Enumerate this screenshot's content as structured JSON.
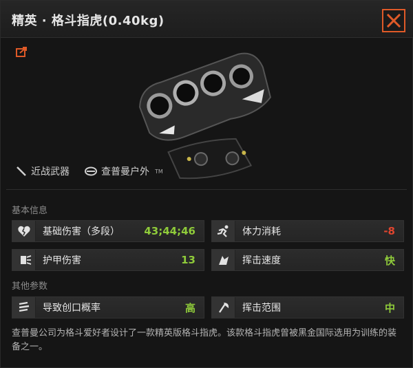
{
  "title": "精英 · 格斗指虎(0.40kg)",
  "tags": {
    "weapon_type": "近战武器",
    "brand": "查普曼户外",
    "brand_mark": "TM"
  },
  "sections": {
    "basic": "基本信息",
    "other": "其他参数"
  },
  "stats": {
    "base_damage": {
      "label": "基础伤害（多段）",
      "value": "43;44;46"
    },
    "stamina_cost": {
      "label": "体力消耗",
      "value": "-8"
    },
    "armor_damage": {
      "label": "护甲伤害",
      "value": "13"
    },
    "swing_speed": {
      "label": "挥击速度",
      "value": "快"
    },
    "bleed_chance": {
      "label": "导致创口概率",
      "value": "高"
    },
    "swing_range": {
      "label": "挥击范围",
      "value": "中"
    }
  },
  "description": "查普曼公司为格斗爱好者设计了一款精英版格斗指虎。该款格斗指虎曾被黑金国际选用为训练的装备之一。",
  "colors": {
    "accent": "#e05a28",
    "positive": "#8fcb3a",
    "negative": "#e0452f"
  }
}
